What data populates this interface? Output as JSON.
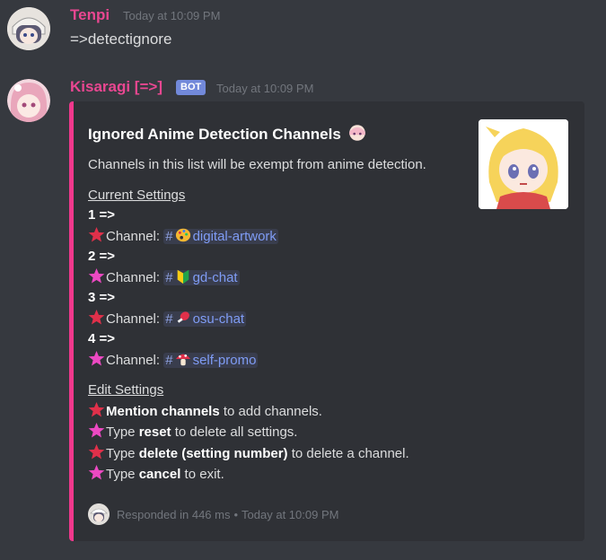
{
  "messages": [
    {
      "author": "Tenpi",
      "timestamp": "Today at 10:09 PM",
      "text": "=>detectignore"
    },
    {
      "author": "Kisaragi [=>]",
      "badge": "BOT",
      "timestamp": "Today at 10:09 PM",
      "embed": {
        "title": "Ignored Anime Detection Channels",
        "description": "Channels in this list will be exempt from anime detection.",
        "current_settings_label": "Current Settings",
        "entries": [
          {
            "num": "1 =>",
            "label": "Channel:",
            "channel": "digital-artwork"
          },
          {
            "num": "2 =>",
            "label": "Channel:",
            "channel": "gd-chat"
          },
          {
            "num": "3 =>",
            "label": "Channel:",
            "channel": "osu-chat"
          },
          {
            "num": "4 =>",
            "label": "Channel:",
            "channel": "self-promo"
          }
        ],
        "edit_settings_label": "Edit Settings",
        "edit_lines": [
          {
            "bold": "Mention channels",
            "rest": " to add channels."
          },
          {
            "pre": "Type ",
            "bold": "reset",
            "rest": " to delete all settings."
          },
          {
            "pre": "Type ",
            "bold": "delete (setting number)",
            "rest": " to delete a channel."
          },
          {
            "pre": "Type ",
            "bold": "cancel",
            "rest": " to exit."
          }
        ],
        "footer_text": "Responded in 446 ms",
        "footer_timestamp": "Today at 10:09 PM",
        "accent_color": "#f0388c"
      }
    }
  ],
  "colors": {
    "background": "#36393f",
    "embed_bg": "#2f3136",
    "author1": "#e94791",
    "author2": "#e94791",
    "star_red": "#e0304a",
    "star_pink": "#ec49c2"
  }
}
